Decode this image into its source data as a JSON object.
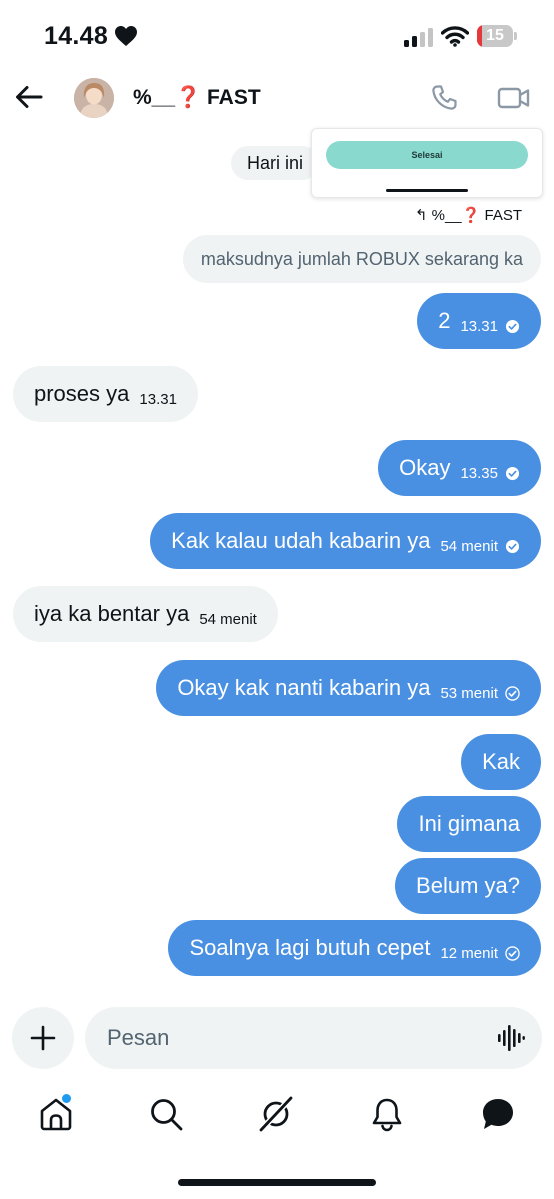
{
  "status_bar": {
    "time": "14.48",
    "battery": "15",
    "battery_level": 0.15
  },
  "header": {
    "contact_name": "%__❓ FAST"
  },
  "popup": {
    "button_label": "Selesai"
  },
  "date_separator": "Hari ini",
  "reply": {
    "to_name": "%__❓ FAST",
    "quoted_text": "maksudnya jumlah ROBUX sekarang ka"
  },
  "messages": [
    {
      "direction": "out",
      "text": "2",
      "time": "13.31",
      "status": "read"
    },
    {
      "direction": "in",
      "text": "proses ya",
      "time": "13.31"
    },
    {
      "direction": "out",
      "text": "Okay",
      "time": "13.35",
      "status": "read"
    },
    {
      "direction": "out",
      "text": "Kak kalau udah kabarin ya",
      "time": "54 menit",
      "status": "read"
    },
    {
      "direction": "in",
      "text": "iya ka bentar ya",
      "time": "54 menit"
    },
    {
      "direction": "out",
      "text": "Okay kak nanti kabarin ya",
      "time": "53 menit",
      "status": "sent"
    },
    {
      "direction": "out",
      "text": "Kak"
    },
    {
      "direction": "out",
      "text": "Ini gimana"
    },
    {
      "direction": "out",
      "text": "Belum ya?"
    },
    {
      "direction": "out",
      "text": "Soalnya lagi butuh cepet",
      "time": "12 menit",
      "status": "sent"
    }
  ],
  "composer": {
    "placeholder": "Pesan"
  },
  "nav": {
    "items": [
      "home-icon",
      "search-icon",
      "grok-icon",
      "notifications-icon",
      "messages-icon"
    ],
    "home_has_badge": true
  },
  "colors": {
    "outgoing": "#4a90e2",
    "incoming": "#eff3f4",
    "accent": "#1d9bf0",
    "popup_button": "#8ad9cf",
    "battery_low": "#e5383b"
  }
}
